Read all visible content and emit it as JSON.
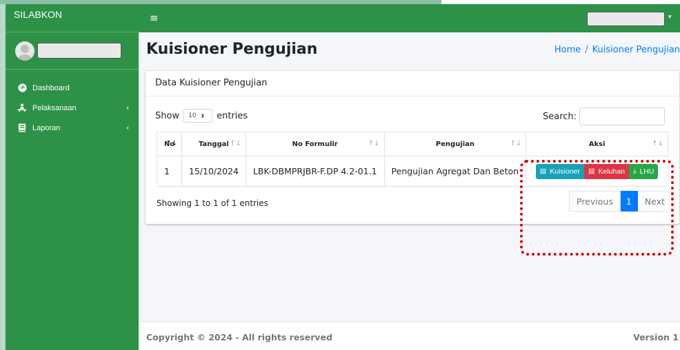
{
  "app": {
    "brand": "SILABKON"
  },
  "sidebar": {
    "items": [
      {
        "label": "Dashboard",
        "icon": "tachometer-icon",
        "has_caret": false
      },
      {
        "label": "Pelaksanaan",
        "icon": "user-chalkboard-icon",
        "has_caret": true
      },
      {
        "label": "Laporan",
        "icon": "book-icon",
        "has_caret": true
      }
    ],
    "caret": "‹"
  },
  "topbar": {
    "menu_icon": "≡",
    "user_caret": "▾"
  },
  "page": {
    "title": "Kuisioner Pengujian"
  },
  "breadcrumb": {
    "home": "Home",
    "separator": "/",
    "current": "Kuisioner Pengujian"
  },
  "card": {
    "title": "Data Kuisioner Pengujian"
  },
  "controls": {
    "show_label": "Show",
    "entries_value": "10",
    "entries_label": "entries",
    "search_label": "Search:",
    "search_value": ""
  },
  "table": {
    "columns": [
      "No",
      "Tanggal",
      "No Formulir",
      "Pengujian",
      "Aksi"
    ],
    "rows": [
      {
        "no": "1",
        "tanggal": "15/10/2024",
        "no_formulir": "LBK-DBMPRJBR-F.DP 4.2-01.1",
        "pengujian": "Pengujian Agregat Dan Beton"
      }
    ],
    "actions": [
      "Kuisioner",
      "Keluhan",
      "LHU"
    ]
  },
  "info": "Showing 1 to 1 of 1 entries",
  "pagination": {
    "previous": "Previous",
    "current": "1",
    "next": "Next"
  },
  "footer": {
    "copyright": "Copyright © 2024 - All rights reserved",
    "version": "Version 1"
  },
  "colors": {
    "sidebar": "#2d9247",
    "primary": "#007bff",
    "info": "#17a2b8",
    "danger": "#dc3545",
    "success": "#28a745",
    "highlight": "#d90000"
  }
}
